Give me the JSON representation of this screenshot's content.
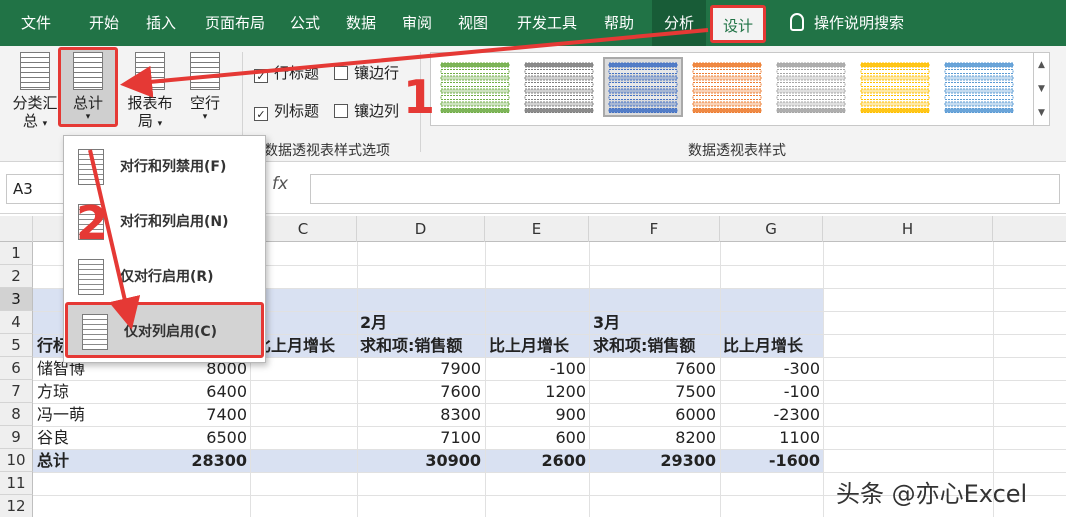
{
  "ribbon_tabs": [
    "文件",
    "开始",
    "插入",
    "页面布局",
    "公式",
    "数据",
    "审阅",
    "视图",
    "开发工具",
    "帮助",
    "分析",
    "设计"
  ],
  "search_label": "操作说明搜索",
  "layout_buttons": {
    "subtotal_line1": "分类汇",
    "subtotal_line2": "总",
    "grand_total": "总计",
    "report_layout_line1": "报表布",
    "report_layout_line2": "局",
    "blank_rows": "空行"
  },
  "style_options": {
    "row_headers": "行标题",
    "banded_rows": "镶边行",
    "col_headers": "列标题",
    "banded_cols": "镶边列",
    "group_label": "数据透视表样式选项"
  },
  "styles_group_label": "数据透视表样式",
  "gallery_colors": [
    "#70ad47",
    "#7f7f7f",
    "#4472c4",
    "#ed7d31",
    "#a5a5a5",
    "#ffc000",
    "#5b9bd5"
  ],
  "name_box": "A3",
  "fx_label": "fx",
  "columns": [
    "C",
    "D",
    "E",
    "F",
    "G",
    "H"
  ],
  "rows": [
    "1",
    "2",
    "3",
    "4",
    "5",
    "6",
    "7",
    "8",
    "9",
    "10",
    "11",
    "12"
  ],
  "dropdown": {
    "items": [
      "对行和列禁用(F)",
      "对行和列启用(N)",
      "仅对行启用(R)",
      "仅对列启用(C)"
    ]
  },
  "pivot": {
    "month2": "2月",
    "month3": "3月",
    "hdr_rowlabel": "行标",
    "hdr_change_a": "比上月增长",
    "hdr_sum": "求和项:销售额",
    "hdr_change_b": "比上月增长",
    "hdr_sum2": "求和项:销售额",
    "hdr_change_c": "比上月增长",
    "data_rows": [
      {
        "name": "储智博",
        "c1": "8000",
        "c2": "7900",
        "c3": "-100",
        "c4": "7600",
        "c5": "-300"
      },
      {
        "name": "方琼",
        "c1": "6400",
        "c2": "7600",
        "c3": "1200",
        "c4": "7500",
        "c5": "-100"
      },
      {
        "name": "冯一萌",
        "c1": "7400",
        "c2": "8300",
        "c3": "900",
        "c4": "6000",
        "c5": "-2300"
      },
      {
        "name": "谷良",
        "c1": "6500",
        "c2": "7100",
        "c3": "600",
        "c4": "8200",
        "c5": "1100"
      }
    ],
    "total_row": {
      "name": "总计",
      "c1": "28300",
      "c2": "30900",
      "c3": "2600",
      "c4": "29300",
      "c5": "-1600"
    }
  },
  "annotations": {
    "step1": "1",
    "step2": "2",
    "color": "#e53935"
  },
  "watermark": "头条 @亦心Excel"
}
